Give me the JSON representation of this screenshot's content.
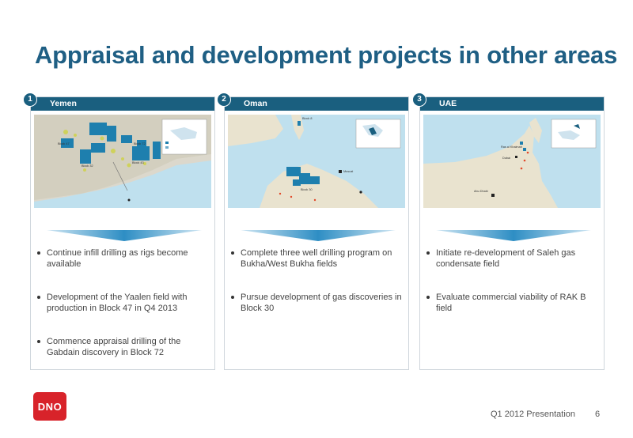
{
  "slide": {
    "title": "Appraisal and development projects in other areas",
    "footer": "Q1 2012 Presentation",
    "page_number": "6",
    "logo": "DNO"
  },
  "panels": [
    {
      "number": "1",
      "heading": "Yemen",
      "map_labels": [
        "Block 47",
        "Block 72",
        "Block 32",
        "Block 43"
      ],
      "bullets": [
        "Continue infill drilling as rigs become available",
        "Development of the Yaalen field with production in Block 47 in Q4 2013",
        "Commence appraisal drilling of the Gabdain discovery in Block 72"
      ]
    },
    {
      "number": "2",
      "heading": "Oman",
      "map_labels": [
        "Muscat",
        "Block 8",
        "Block 30"
      ],
      "bullets": [
        "Complete three well drilling program on Bukha/West Bukha fields",
        "Pursue development of gas discoveries in Block 30"
      ]
    },
    {
      "number": "3",
      "heading": "UAE",
      "map_labels": [
        "Ras al Khaimah",
        "Dubai",
        "Abu Dhabi"
      ],
      "bullets": [
        "Initiate re-development of Saleh gas condensate field",
        "Evaluate commercial viability of RAK B field"
      ]
    }
  ],
  "colors": {
    "title": "#1f5f84",
    "header": "#1a5f7f",
    "block": "#1e7fae",
    "logo": "#d8232a"
  }
}
